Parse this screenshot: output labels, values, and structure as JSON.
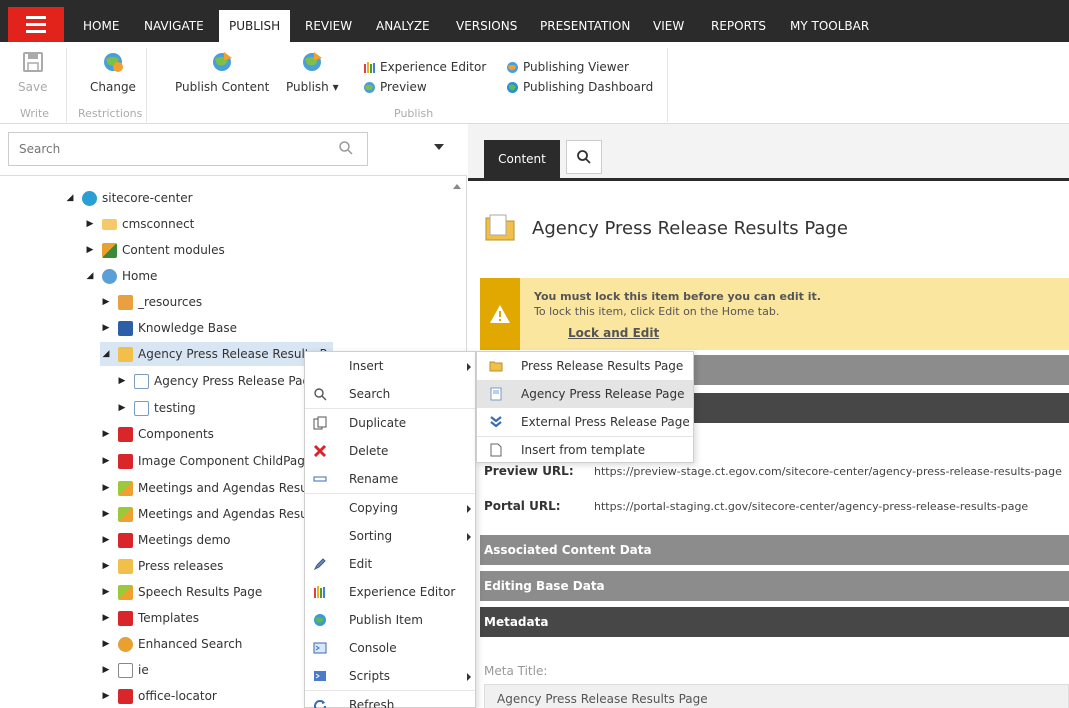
{
  "colors": {
    "topbar": "#2b2b2b",
    "accent": "#e1231b",
    "warning": "#fbe6a0",
    "warning_bar": "#e0a800",
    "section_dark": "#474747",
    "section_gray": "#8c8c8c",
    "selected": "#d8e5f3"
  },
  "nav": {
    "tabs": [
      "HOME",
      "NAVIGATE",
      "PUBLISH",
      "REVIEW",
      "ANALYZE",
      "VERSIONS",
      "PRESENTATION",
      "VIEW",
      "REPORTS",
      "MY TOOLBAR"
    ],
    "active_tab": "PUBLISH"
  },
  "ribbon": {
    "save": "Save",
    "write_group": "Write",
    "change": "Change",
    "restrictions_group": "Restrictions",
    "publish_content": "Publish Content",
    "publish": "Publish",
    "experience_editor": "Experience Editor",
    "preview": "Preview",
    "publishing_viewer": "Publishing Viewer",
    "publishing_dashboard": "Publishing Dashboard",
    "publish_group": "Publish"
  },
  "search": {
    "placeholder": "Search"
  },
  "tree": {
    "items": [
      {
        "label": "sitecore-center",
        "icon": "globe-icon"
      },
      {
        "label": "cmsconnect",
        "icon": "folder-icon"
      },
      {
        "label": "Content modules",
        "icon": "modules-icon"
      },
      {
        "label": "Home",
        "icon": "home-icon"
      },
      {
        "label": "_resources",
        "icon": "resources-icon"
      },
      {
        "label": "Knowledge Base",
        "icon": "knowledge-icon"
      },
      {
        "label": "Agency Press Release Results P",
        "icon": "folder-icon"
      },
      {
        "label": "Agency Press Release Page",
        "icon": "page-icon"
      },
      {
        "label": "testing",
        "icon": "page-icon"
      },
      {
        "label": "Components",
        "icon": "component-icon"
      },
      {
        "label": "Image Component ChildPage",
        "icon": "component-icon"
      },
      {
        "label": "Meetings and Agendas Results",
        "icon": "meeting-icon"
      },
      {
        "label": "Meetings and Agendas Results",
        "icon": "meeting-icon"
      },
      {
        "label": "Meetings demo",
        "icon": "component-icon"
      },
      {
        "label": "Press releases",
        "icon": "folder-icon"
      },
      {
        "label": "Speech Results Page",
        "icon": "meeting-icon"
      },
      {
        "label": "Templates",
        "icon": "component-icon"
      },
      {
        "label": "Enhanced Search",
        "icon": "search-icon"
      },
      {
        "label": "ie",
        "icon": "page-icon"
      },
      {
        "label": "office-locator",
        "icon": "component-icon"
      }
    ]
  },
  "content_tabs": {
    "content": "Content"
  },
  "item": {
    "title": "Agency Press Release Results Page"
  },
  "warning": {
    "title": "You must lock this item before you can edit it.",
    "subtitle": "To lock this item, click Edit on the Home tab.",
    "link": "Lock and Edit"
  },
  "info": {
    "preview_label": "Preview URL:",
    "preview_value": "https://preview-stage.ct.egov.com/sitecore-center/agency-press-release-results-page",
    "portal_label": "Portal URL:",
    "portal_value": "https://portal-staging.ct.gov/sitecore-center/agency-press-release-results-page"
  },
  "sections": {
    "associated": "Associated Content Data",
    "editing_base": "Editing Base Data",
    "metadata": "Metadata"
  },
  "meta": {
    "title_label": "Meta Title:",
    "title_value": "Agency Press Release Results Page"
  },
  "context_menu": {
    "items": [
      {
        "label": "Insert",
        "icon": "none",
        "submenu": true
      },
      {
        "label": "Search",
        "icon": "search-icon",
        "submenu": false
      },
      {
        "label": "Duplicate",
        "icon": "duplicate-icon",
        "submenu": false
      },
      {
        "label": "Delete",
        "icon": "delete-icon",
        "submenu": false
      },
      {
        "label": "Rename",
        "icon": "rename-icon",
        "submenu": false
      },
      {
        "label": "Copying",
        "icon": "none",
        "submenu": true
      },
      {
        "label": "Sorting",
        "icon": "none",
        "submenu": true
      },
      {
        "label": "Edit",
        "icon": "edit-icon",
        "submenu": false
      },
      {
        "label": "Experience Editor",
        "icon": "experience-editor-icon",
        "submenu": false
      },
      {
        "label": "Publish Item",
        "icon": "publish-icon",
        "submenu": false
      },
      {
        "label": "Console",
        "icon": "console-icon",
        "submenu": false
      },
      {
        "label": "Scripts",
        "icon": "scripts-icon",
        "submenu": true
      },
      {
        "label": "Refresh",
        "icon": "refresh-icon",
        "submenu": false
      }
    ]
  },
  "insert_submenu": {
    "items": [
      {
        "label": "Press Release Results Page",
        "icon": "folder-icon"
      },
      {
        "label": "Agency Press Release Page",
        "icon": "page-icon"
      },
      {
        "label": "External Press Release Page",
        "icon": "chevrons-icon"
      },
      {
        "label": "Insert from template",
        "icon": "template-icon"
      }
    ]
  }
}
